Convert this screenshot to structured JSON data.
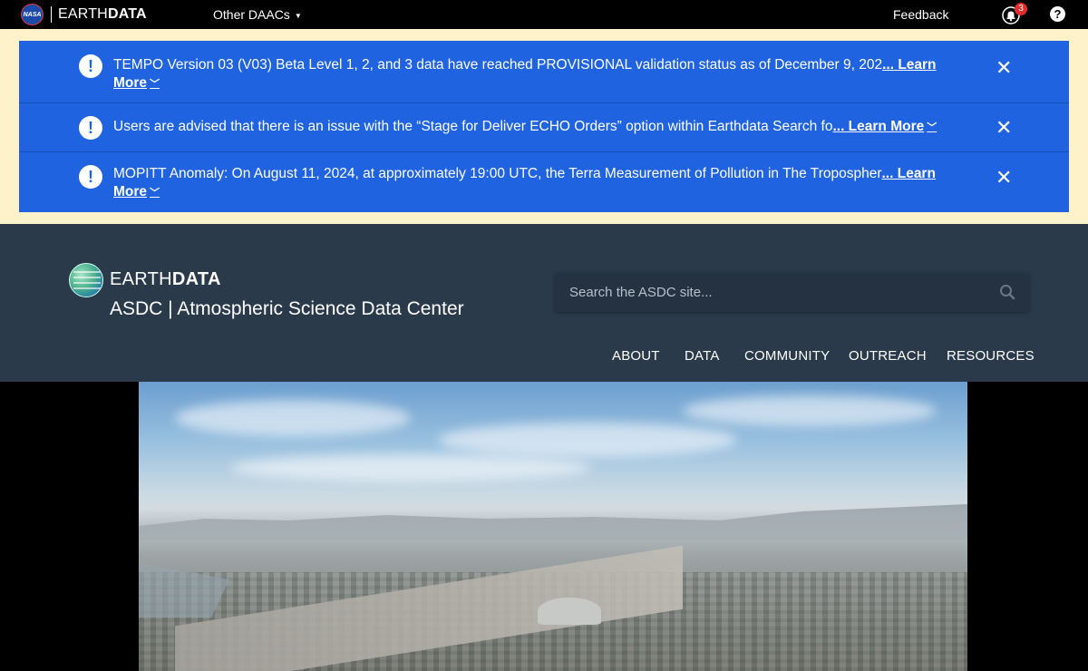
{
  "topbar": {
    "logo_label": "NASA",
    "brand_prefix": "EARTH",
    "brand_bold": "DATA",
    "other_daacs": "Other DAACs",
    "feedback": "Feedback",
    "notification_count": "3",
    "help": "?"
  },
  "banners": [
    {
      "text": "TEMPO Version 03 (V03) Beta Level 1, 2, and 3 data have reached PROVISIONAL validation status as of December 9, 202",
      "learn_more": "... Learn More"
    },
    {
      "text": "Users are advised that there is an issue with the “Stage for Deliver ECHO Orders” option within Earthdata Search fo",
      "learn_more": "... Learn More"
    },
    {
      "text": "MOPITT Anomaly: On August 11, 2024, at approximately 19:00 UTC, the Terra Measurement of Pollution in The Tropospher",
      "learn_more": "... Learn More"
    }
  ],
  "site": {
    "brand_prefix": "EARTH",
    "brand_bold": "DATA",
    "subtitle": "ASDC | Atmospheric Science Data Center",
    "search_placeholder": "Search the ASDC site..."
  },
  "nav": {
    "about": "ABOUT",
    "data": "DATA",
    "community": "COMMUNITY",
    "outreach": "OUTREACH",
    "resources": "RESOURCES"
  },
  "colors": {
    "banner_blue": "#1f63e0",
    "banner_bg": "#fdf2c9",
    "header_bg": "#2a3a4b",
    "badge_red": "#e52b2b"
  }
}
